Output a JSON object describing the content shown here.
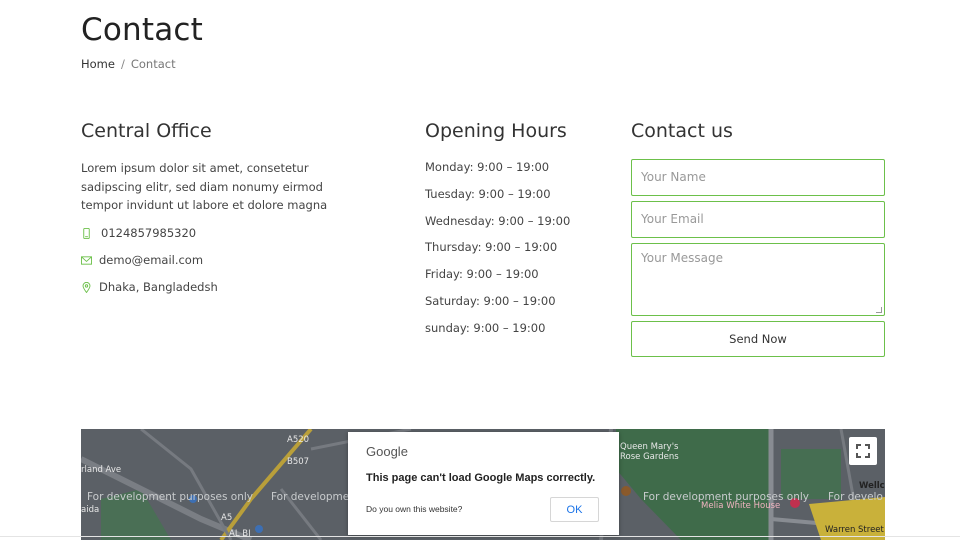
{
  "page": {
    "title": "Contact",
    "breadcrumb": {
      "home": "Home",
      "separator": "/",
      "current": "Contact"
    }
  },
  "office": {
    "title": "Central Office",
    "description": "Lorem ipsum dolor sit amet, consetetur sadipscing elitr, sed diam nonumy eirmod tempor invidunt ut labore et dolore magna",
    "phone": "0124857985320",
    "email": "demo@email.com",
    "address": "Dhaka, Bangladedsh",
    "icons": {
      "phone": "phone-icon",
      "email": "envelope-icon",
      "address": "map-pin-icon"
    }
  },
  "hours": {
    "title": "Opening Hours",
    "items": [
      "Monday: 9:00 – 19:00",
      "Tuesday: 9:00 – 19:00",
      "Wednesday: 9:00 – 19:00",
      "Thursday: 9:00 – 19:00",
      "Friday: 9:00 – 19:00",
      "Saturday: 9:00 – 19:00",
      "sunday: 9:00 – 19:00"
    ]
  },
  "contact_form": {
    "title": "Contact us",
    "name_placeholder": "Your Name",
    "email_placeholder": "Your Email",
    "message_placeholder": "Your Message",
    "submit_label": "Send Now"
  },
  "map": {
    "dev_notice": "For development purposes only",
    "dev_notice_short": "For developme",
    "dev_notice_clip": "For develo",
    "labels": {
      "park": "Queen Mary's Rose Gardens",
      "restaurant": "Melia White House",
      "street": "Warren Street",
      "corner": "Wellc",
      "road_left_1": "rland Ave",
      "road_left_2": "aida",
      "road_top": "A520",
      "road_b507": "B507",
      "road_a5": "A5",
      "albi": "AL BI"
    },
    "dialog": {
      "brand": "Google",
      "message": "This page can't load Google Maps correctly.",
      "own_question": "Do you own this website?",
      "ok_label": "OK"
    }
  },
  "colors": {
    "accent": "#6cc04a",
    "map_base": "#5b6066",
    "map_green": "#3f6b4a",
    "link_blue": "#1a73e8"
  }
}
